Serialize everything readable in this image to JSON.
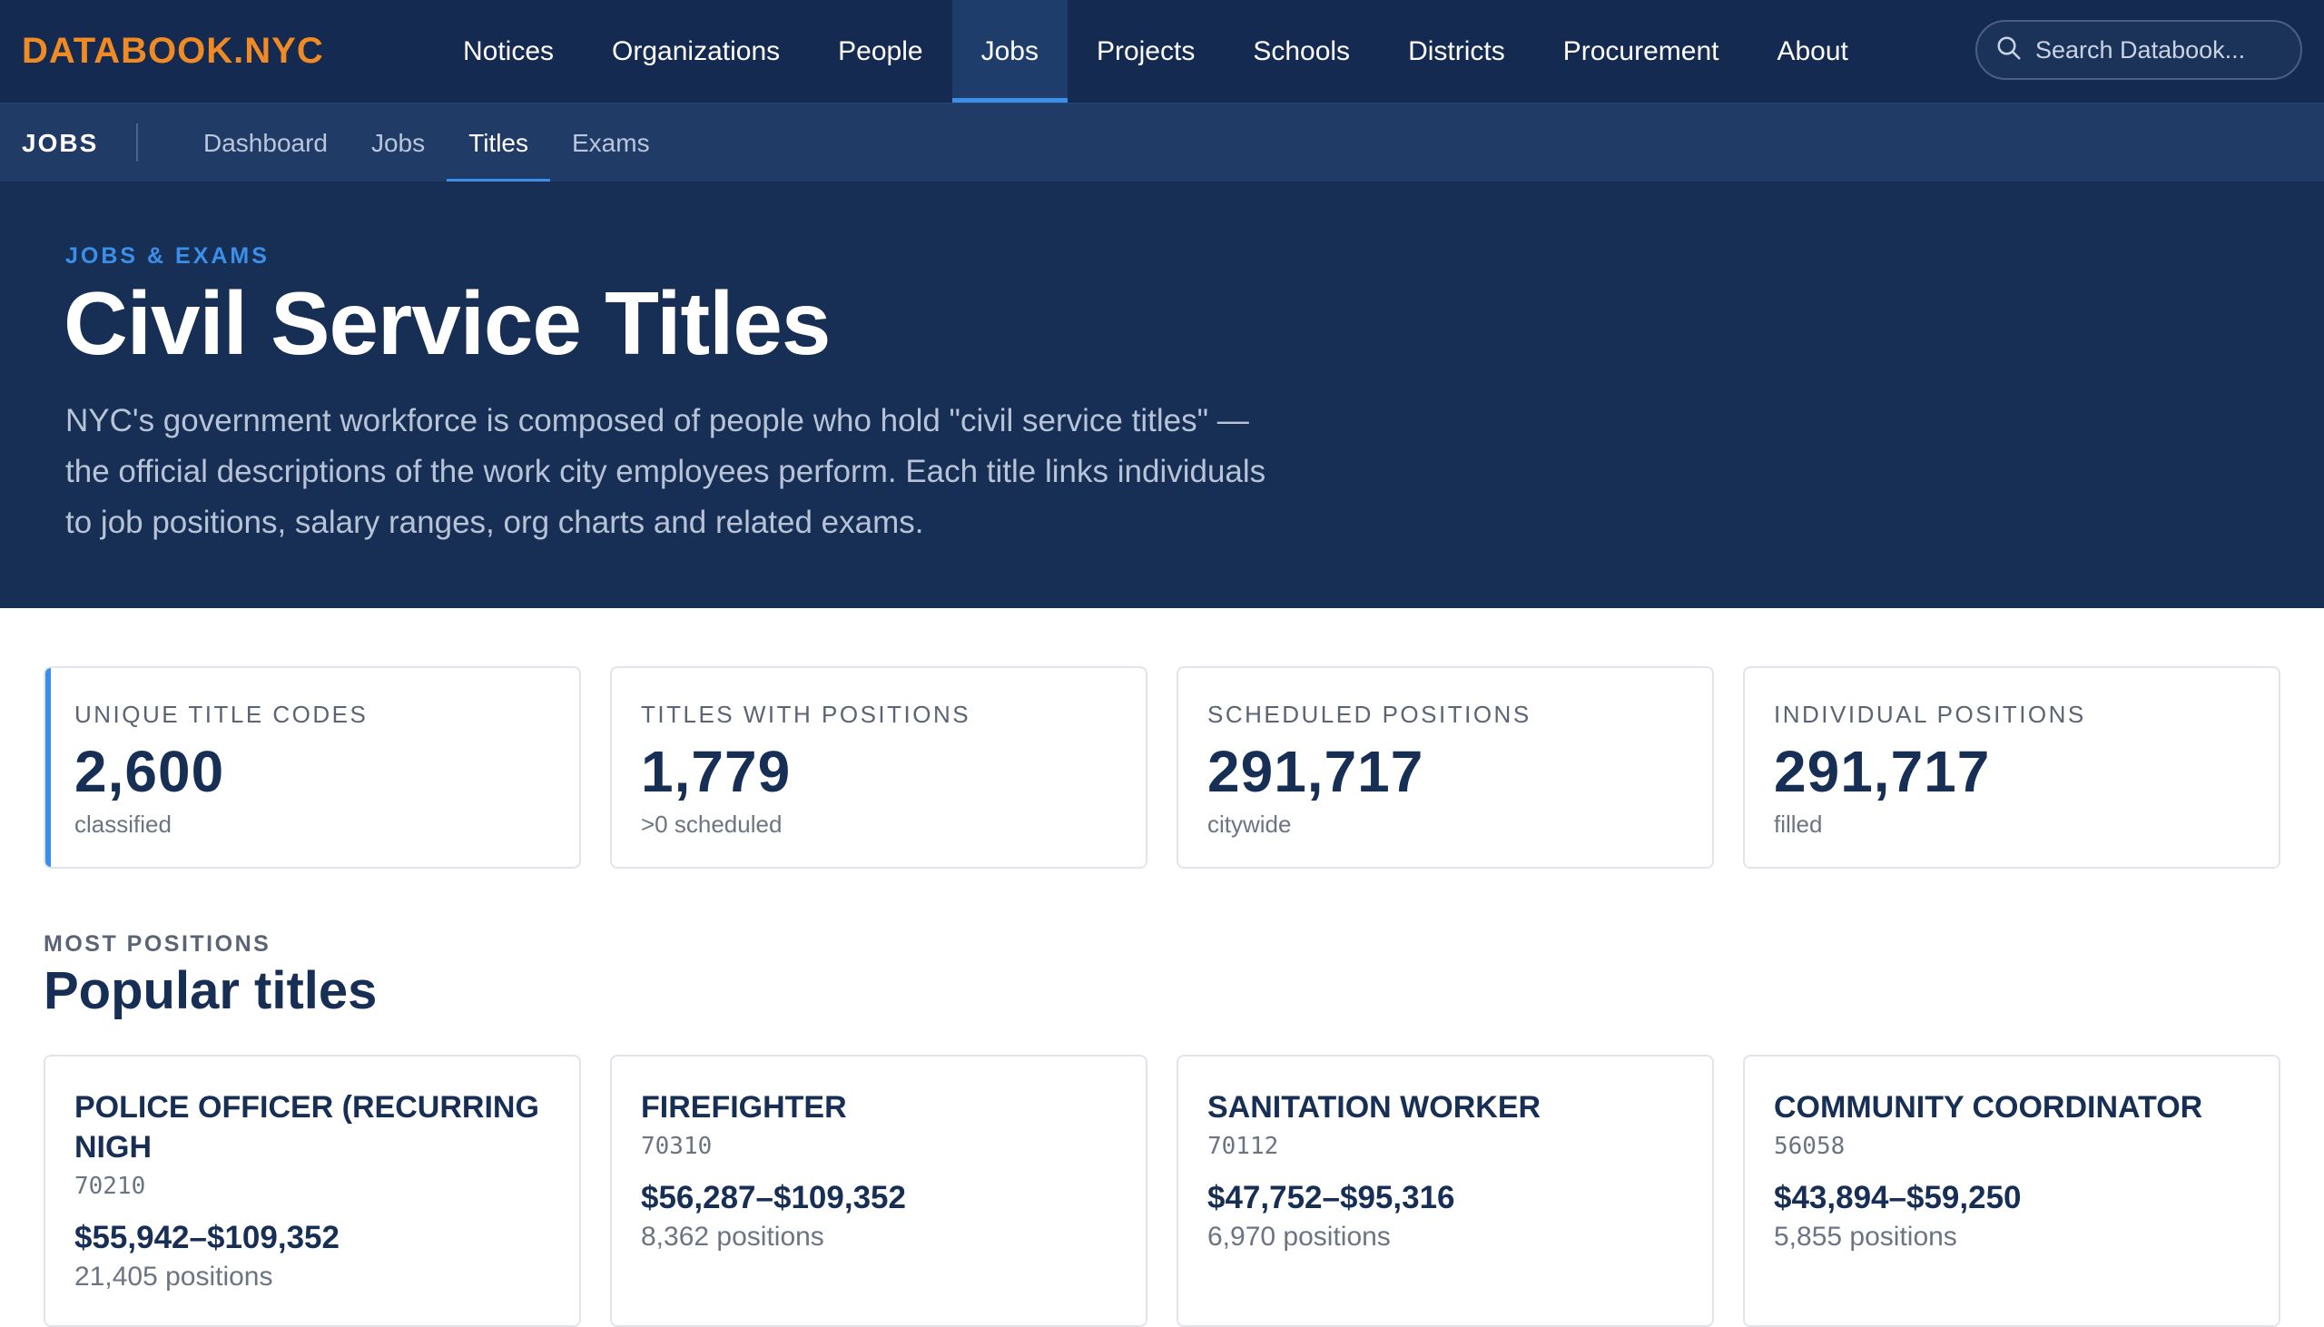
{
  "brand": {
    "logo": "DATABOOK.NYC"
  },
  "nav": {
    "items": [
      {
        "label": "Notices"
      },
      {
        "label": "Organizations"
      },
      {
        "label": "People"
      },
      {
        "label": "Jobs"
      },
      {
        "label": "Projects"
      },
      {
        "label": "Schools"
      },
      {
        "label": "Districts"
      },
      {
        "label": "Procurement"
      },
      {
        "label": "About"
      }
    ],
    "active": "Jobs",
    "search_placeholder": "Search Databook..."
  },
  "subnav": {
    "title": "JOBS",
    "items": [
      {
        "label": "Dashboard"
      },
      {
        "label": "Jobs"
      },
      {
        "label": "Titles"
      },
      {
        "label": "Exams"
      }
    ],
    "active": "Titles"
  },
  "hero": {
    "eyebrow": "JOBS & EXAMS",
    "title": "Civil Service Titles",
    "description": "NYC's government workforce is composed of people who hold \"civil service titles\" — the official descriptions of the work city employees perform. Each title links individuals to job positions, salary ranges, org charts and related exams."
  },
  "stats": [
    {
      "label": "UNIQUE TITLE CODES",
      "value": "2,600",
      "sub": "classified"
    },
    {
      "label": "TITLES WITH POSITIONS",
      "value": "1,779",
      "sub": ">0 scheduled"
    },
    {
      "label": "SCHEDULED POSITIONS",
      "value": "291,717",
      "sub": "citywide"
    },
    {
      "label": "INDIVIDUAL POSITIONS",
      "value": "291,717",
      "sub": "filled"
    }
  ],
  "popular": {
    "eyebrow": "MOST POSITIONS",
    "title": "Popular titles",
    "titles": [
      {
        "name": "POLICE OFFICER (RECURRING NIGH",
        "code": "70210",
        "salary": "$55,942–$109,352",
        "positions": "21,405 positions"
      },
      {
        "name": "FIREFIGHTER",
        "code": "70310",
        "salary": "$56,287–$109,352",
        "positions": "8,362 positions"
      },
      {
        "name": "SANITATION WORKER",
        "code": "70112",
        "salary": "$47,752–$95,316",
        "positions": "6,970 positions"
      },
      {
        "name": "COMMUNITY COORDINATOR",
        "code": "56058",
        "salary": "$43,894–$59,250",
        "positions": "5,855 positions"
      }
    ]
  },
  "colors": {
    "nav_bg": "#142a50",
    "subnav_bg": "#203b65",
    "hero_bg": "#172e55",
    "accent": "#3b8fe8",
    "logo": "#f08a24"
  }
}
